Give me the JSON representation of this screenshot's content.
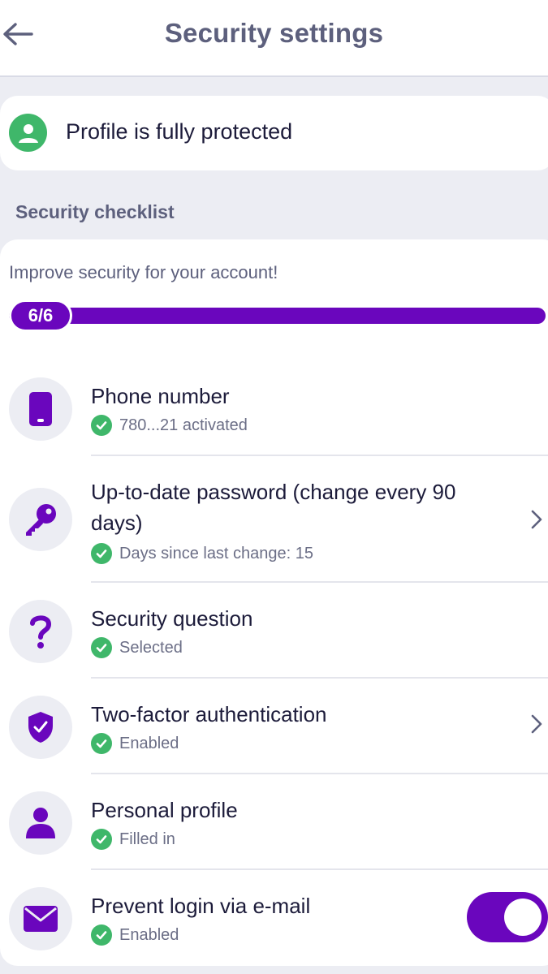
{
  "header": {
    "title": "Security settings",
    "back_icon": "arrow-left-icon"
  },
  "protection": {
    "text": "Profile is fully protected",
    "icon": "user-shield-icon",
    "color": "#3fb76a"
  },
  "checklist": {
    "section_label": "Security checklist",
    "subtitle": "Improve security for your account!",
    "progress": {
      "completed": 6,
      "total": 6,
      "label": "6/6"
    },
    "accent_color": "#6a06bd",
    "items": [
      {
        "title": "Phone number",
        "status": "780...21 activated",
        "icon": "phone-icon",
        "chevron": false
      },
      {
        "title_line1": "Up-to-date password (change every 90",
        "title_line2": "days)",
        "status": "Days since last change: 15",
        "icon": "key-icon",
        "chevron": true
      },
      {
        "title": "Security question",
        "status": "Selected",
        "icon": "question-mark-icon",
        "chevron": false
      },
      {
        "title": "Two-factor authentication",
        "status": "Enabled",
        "icon": "shield-check-icon",
        "chevron": true
      },
      {
        "title": "Personal profile",
        "status": "Filled in",
        "icon": "person-icon",
        "chevron": false
      },
      {
        "title": "Prevent login via e-mail",
        "status": "Enabled",
        "icon": "envelope-icon",
        "toggle_on": true
      }
    ]
  }
}
